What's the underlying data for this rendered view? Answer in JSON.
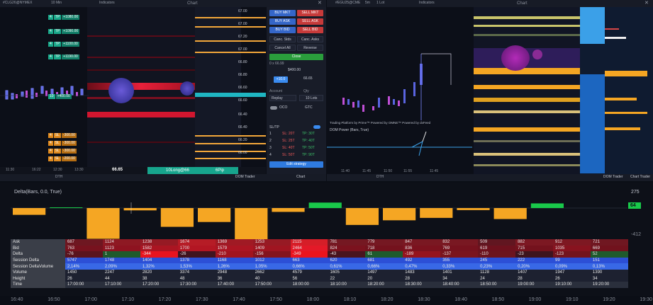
{
  "left_panel": {
    "title": "Chart",
    "symbol": "#CLG26@NYMEX",
    "timeframe": "10 Min",
    "mode": "Indicators",
    "dom_tab": "DOM Trader",
    "chart_tab": "Chart",
    "price_box": "66.65",
    "position_label": "10Long@66",
    "pl_label": "6Pip",
    "bottom_zoom": "DTH",
    "time_ticks": [
      "11:30",
      "16:22",
      "12:30",
      "13:30"
    ],
    "price_levels": [
      "67.00",
      "67.00",
      "67.20",
      "67.00",
      "66.80",
      "66.80",
      "66.60",
      "66.60",
      "66.40",
      "66.40",
      "66.20",
      "66.00"
    ],
    "buy_orders": [
      {
        "label": "TP",
        "qty": "4",
        "price": "+1080.00"
      },
      {
        "label": "TP",
        "qty": "4",
        "price": "+1090.00"
      },
      {
        "label": "TP",
        "qty": "4",
        "price": "+1100.00"
      },
      {
        "label": "TP",
        "qty": "4",
        "price": "+1190.00"
      },
      {
        "label": "",
        "qty": "10",
        "price": "+400.00"
      }
    ],
    "sell_orders": [
      {
        "label": "SL",
        "qty": "4",
        "price": "-300.00"
      },
      {
        "label": "SL",
        "qty": "4",
        "price": "-300.00"
      },
      {
        "label": "SL",
        "qty": "4",
        "price": "-300.00"
      },
      {
        "label": "SL",
        "qty": "4",
        "price": "-200.00"
      }
    ]
  },
  "order_panel": {
    "buy_mkt": "BUY MKT",
    "sell_mkt": "SELL MKT",
    "buy_ask": "BUY ASK",
    "sell_ask": "SELL ASK",
    "buy_bid": "BUY BID",
    "sell_bid": "SELL BID",
    "canc_stds": "Canc. Stds",
    "canc_asks": "Canc. Asks",
    "cancel_all": "Cancel All",
    "reverse": "Reverse",
    "close": "Close",
    "pos_line1": "0 x 66.99",
    "pos_line2": "$400.00",
    "qty_value": "+10.0",
    "last_price": "66.65",
    "account_label": "Account",
    "account_value": "Replay",
    "qty_label": "Qty",
    "qty_field": "10 Lots",
    "oco_label": "OCO",
    "tif": "GTC",
    "sltp_label": "SL/TP",
    "sltp_rows": [
      {
        "n": "1",
        "sl": "SL: 20T",
        "tp": "TP: 30T"
      },
      {
        "n": "2",
        "sl": "SL: 25T",
        "tp": "TP: 40T"
      },
      {
        "n": "3",
        "sl": "SL: 40T",
        "tp": "TP: 50T"
      },
      {
        "n": "4",
        "sl": "SL: 50T",
        "tp": "TP: 90T"
      }
    ],
    "edit_strategy": "Edit strategy"
  },
  "right_panel": {
    "title": "Chart",
    "symbol": "#EGU25@CME",
    "timeframe": "5m",
    "qty": "1 Lot",
    "mode": "Indicators",
    "footer_line": "Trading Platform by Prime™   Powered by OMNE™   Powered by dxFeed",
    "indicator_label": "DOM Power (Bars, True)",
    "time_ticks": [
      "11:40",
      "11:45",
      "11:50",
      "11:55",
      "11:45"
    ],
    "dom_tab": "DOM Trader",
    "chart_tab": "Chart Trader",
    "bottom_zoom": "DTH"
  },
  "bottom_panel": {
    "indicator": "Delta(Bars, 0.0, True)",
    "axis_top": "275",
    "axis_mid": "64",
    "axis_bot": "-412",
    "rows": [
      {
        "label": "Ask",
        "values": [
          "687",
          "1124",
          "1238",
          "1674",
          "1369",
          "1253",
          "2115",
          "781",
          "779",
          "847",
          "832",
          "509",
          "882",
          "912",
          "721"
        ]
      },
      {
        "label": "Bid",
        "values": [
          "763",
          "1123",
          "1582",
          "1700",
          "1579",
          "1409",
          "2464",
          "824",
          "718",
          "836",
          "769",
          "619",
          "715",
          "1035",
          "669"
        ]
      },
      {
        "label": "Delta",
        "values": [
          "-76",
          "1",
          "-344",
          "-26",
          "-210",
          "-156",
          "-349",
          "-43",
          "61",
          "-189",
          "-137",
          "-110",
          "-23",
          "-123",
          "52"
        ]
      },
      {
        "label": "Session Delta",
        "values": [
          "5747",
          "1748",
          "1404",
          "1378",
          "1168",
          "1012",
          "663",
          "620",
          "681",
          "492",
          "355",
          "245",
          "222",
          "99",
          "151"
        ]
      },
      {
        "label": "Session DeltaVolume",
        "values": [
          "2,14%",
          "2,09%",
          "1,32%",
          "1,53%",
          "1,26%",
          "1,05%",
          "0,66%",
          "0,61%",
          "0,66%",
          "0,47%",
          "0,33%",
          "0,23%",
          "0,20%",
          "0,09%",
          "0,13%"
        ]
      },
      {
        "label": "Volume",
        "values": [
          "1450",
          "2247",
          "2820",
          "3374",
          "2948",
          "2662",
          "4579",
          "1605",
          "1497",
          "1483",
          "1401",
          "1128",
          "1407",
          "1947",
          "1390"
        ]
      },
      {
        "label": "Height",
        "values": [
          "26",
          "44",
          "38",
          "48",
          "36",
          "40",
          "56",
          "22",
          "20",
          "28",
          "34",
          "24",
          "28",
          "26",
          "34"
        ]
      },
      {
        "label": "Time",
        "values": [
          "17:00:00",
          "17:10:00",
          "17:20:00",
          "17:30:00",
          "17:40:00",
          "17:50:00",
          "18:00:00",
          "18:10:00",
          "18:20:00",
          "18:30:00",
          "18:40:00",
          "18:50:00",
          "19:00:00",
          "19:10:00",
          "19:20:00"
        ]
      }
    ],
    "time_axis": [
      "16:40",
      "16:50",
      "17:00",
      "17:10",
      "17:20",
      "17:30",
      "17:40",
      "17:50",
      "18:00",
      "18:10",
      "18:20",
      "18:30",
      "18:40",
      "18:50",
      "19:00",
      "19:10",
      "19:20",
      "19:30"
    ]
  },
  "chart_data": {
    "type": "bar",
    "title": "Delta(Bars, 0.0, True)",
    "categories": [
      "17:00",
      "17:10",
      "17:20",
      "17:30",
      "17:40",
      "17:50",
      "18:00",
      "18:10",
      "18:20",
      "18:30",
      "18:40",
      "18:50",
      "19:00",
      "19:10",
      "19:20"
    ],
    "series": [
      {
        "name": "Delta",
        "values": [
          -76,
          1,
          -344,
          -26,
          -210,
          -156,
          -349,
          -43,
          61,
          -189,
          -137,
          -110,
          -23,
          -123,
          52
        ]
      }
    ],
    "ylim": [
      -412,
      275
    ],
    "colors": {
      "negative": "#f5a623",
      "positive": "#19c94a"
    }
  }
}
